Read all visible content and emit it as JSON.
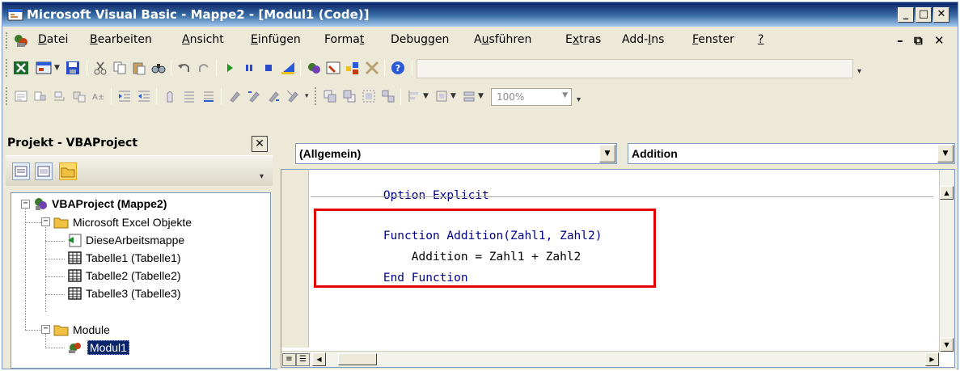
{
  "window": {
    "title": "Microsoft Visual Basic - Mappe2 - [Modul1 (Code)]",
    "buttons": {
      "minimize": "_",
      "maximize": "□",
      "close": "✕"
    }
  },
  "menu": {
    "items": [
      "Datei",
      "Bearbeiten",
      "Ansicht",
      "Einfügen",
      "Format",
      "Debuggen",
      "Ausführen",
      "Extras",
      "Add-Ins",
      "Fenster",
      "?"
    ],
    "mdi_minimize": "–",
    "mdi_restore": "⧉",
    "mdi_close": "✕"
  },
  "toolbar2": {
    "zoom": "100%"
  },
  "project": {
    "title": "Projekt - VBAProject",
    "close": "✕",
    "tree": {
      "root": "VBAProject (Mappe2)",
      "excel_objects": "Microsoft Excel Objekte",
      "workbook": "DieseArbeitsmappe",
      "sheets": [
        "Tabelle1 (Tabelle1)",
        "Tabelle2 (Tabelle2)",
        "Tabelle3 (Tabelle3)"
      ],
      "modules": "Module",
      "module1": "Modul1"
    }
  },
  "code": {
    "object_combo": "(Allgemein)",
    "proc_combo": "Addition",
    "lines": [
      "Option Explicit",
      "Function Addition(Zahl1, Zahl2)",
      "    Addition = Zahl1 + Zahl2",
      "End Function"
    ]
  },
  "colors": {
    "highlight_box": "#e50000",
    "keyword": "#00008b",
    "title_bar": "#0a246a"
  }
}
